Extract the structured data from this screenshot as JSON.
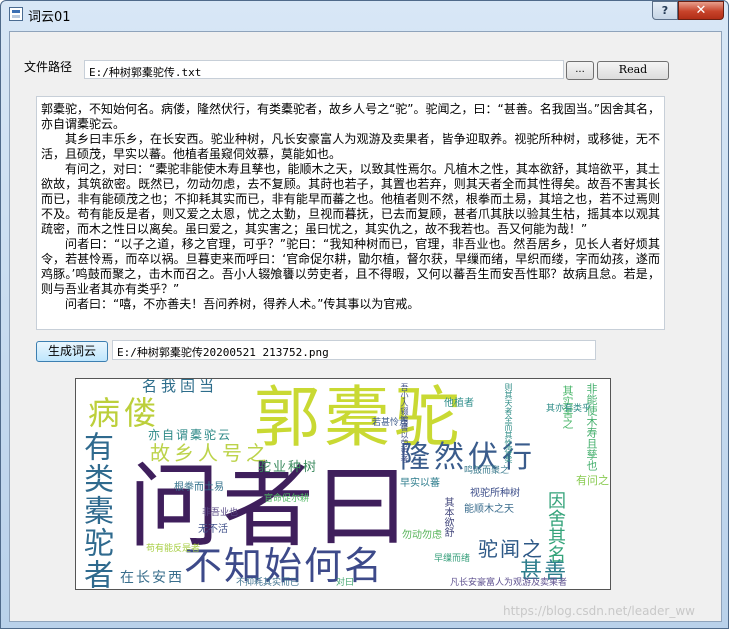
{
  "window": {
    "title": "词云01",
    "help_label": "?",
    "close_label": "✕"
  },
  "file_row": {
    "label": "文件路径",
    "path_value": "E:/种树郭橐驼传.txt",
    "browse_label": "...",
    "read_label": "Read"
  },
  "content": {
    "paragraphs": [
      "郭橐驼，不知始何名。病偻，隆然伏行，有类橐驼者，故乡人号之“驼”。驼闻之，曰：“甚善。名我固当。”因舍其名，亦自谓橐驼云。",
      "其乡曰丰乐乡，在长安西。驼业种树，凡长安豪富人为观游及卖果者，皆争迎取养。视驼所种树，或移徙，无不活，且硕茂，早实以蕃。他植者虽窥伺效慕，莫能如也。",
      "有问之，对曰：“橐驼非能使木寿且孳也，能顺木之天，以致其性焉尔。凡植木之性，其本欲舒，其培欲平，其土欲故，其筑欲密。既然已，勿动勿虑，去不复顾。其莳也若子，其置也若弃，则其天者全而其性得矣。故吾不害其长而已，非有能硕茂之也；不抑耗其实而已，非有能早而蕃之也。他植者则不然，根拳而土易，其培之也，若不过焉则不及。苟有能反是者，则又爱之太恩，忧之太勤，旦视而暮抚，已去而复顾，甚者爪其肤以验其生枯，摇其本以观其疏密，而木之性日以离矣。虽曰爱之，其实害之；虽曰忧之，其实仇之，故不我若也。吾又何能为哉！”",
      "问者曰：“以子之道，移之官理，可乎？”驼曰：“我知种树而已，官理，非吾业也。然吾居乡，见长人者好烦其令，若甚怜焉，而卒以祸。旦暮吏来而呼曰：‘官命促尔耕，勖尔植，督尔获，早缫而绪，早织而缕，字而幼孩，遂而鸡豚。’鸣鼓而聚之，击木而召之。吾小人辍飧饔以劳吏者，且不得暇，又何以蕃吾生而安吾性耶？故病且怠。若是，则与吾业者其亦有类乎？”",
      "问者曰：“嘻，不亦善夫！吾问养树，得养人术。”传其事以为官戒。"
    ]
  },
  "generate_row": {
    "button_label": "生成词云",
    "output_value": "E:/种树郭橐驼传20200521 213752.png"
  },
  "cloud": {
    "words": [
      {
        "text": "郭橐驼",
        "color": "#c9d933"
      },
      {
        "text": "问者曰",
        "color": "#3f1f5c"
      },
      {
        "text": "不知始何名",
        "color": "#3d4a8a"
      },
      {
        "text": "有类橐驼者",
        "color": "#2f6a8e"
      },
      {
        "text": "病偻",
        "color": "#bccf3b"
      },
      {
        "text": "隆然伏行",
        "color": "#3a5c8c"
      },
      {
        "text": "故乡人号之",
        "color": "#bcd34a"
      },
      {
        "text": "驼闻之",
        "color": "#2d5886"
      },
      {
        "text": "甚善",
        "color": "#2c7d8c"
      },
      {
        "text": "因舍其名",
        "color": "#34a37a"
      },
      {
        "text": "名我固当",
        "color": "#2d6d8b"
      },
      {
        "text": "亦自谓橐驼云",
        "color": "#2f8a88"
      },
      {
        "text": "驼业种树",
        "color": "#3b8a5e"
      },
      {
        "text": "在长安西",
        "color": "#3a6f8d"
      },
      {
        "text": "非能使木寿且孳也",
        "color": "#46b06e"
      },
      {
        "text": "根拳而土易",
        "color": "#35728c"
      },
      {
        "text": "视驼所种树",
        "color": "#3e4f8a"
      },
      {
        "text": "其实害之",
        "color": "#4ab66a"
      },
      {
        "text": "有问之",
        "color": "#8acb52"
      },
      {
        "text": "能顺木之天",
        "color": "#3a6c8d"
      },
      {
        "text": "他植者",
        "color": "#2f8e8b"
      },
      {
        "text": "其本欲舒",
        "color": "#44487d"
      },
      {
        "text": "勿动勿虑",
        "color": "#58b45a"
      },
      {
        "text": "无不活",
        "color": "#3f508a"
      },
      {
        "text": "早实以蕃",
        "color": "#2d7c8c"
      },
      {
        "text": "凡长安豪富人为观游及卖果者",
        "color": "#5f5290"
      },
      {
        "text": "不抑耗其实而已",
        "color": "#3d6f8c"
      },
      {
        "text": "对曰",
        "color": "#46a872"
      },
      {
        "text": "苟有能反是者",
        "color": "#a8cf45"
      },
      {
        "text": "其亦有类乎",
        "color": "#2f8d88"
      },
      {
        "text": "若甚怜焉",
        "color": "#3d5b8b"
      },
      {
        "text": "官命促尔耕",
        "color": "#4fb863"
      },
      {
        "text": "鸣鼓而聚之",
        "color": "#3a7a8c"
      },
      {
        "text": "吾小人辍飧饔以劳吏者",
        "color": "#3f4d87"
      },
      {
        "text": "则其天者全而其性得矣",
        "color": "#35908a"
      },
      {
        "text": "非吾业也",
        "color": "#5a4a86"
      },
      {
        "text": "早缫而绪",
        "color": "#38a07c"
      }
    ]
  }
}
